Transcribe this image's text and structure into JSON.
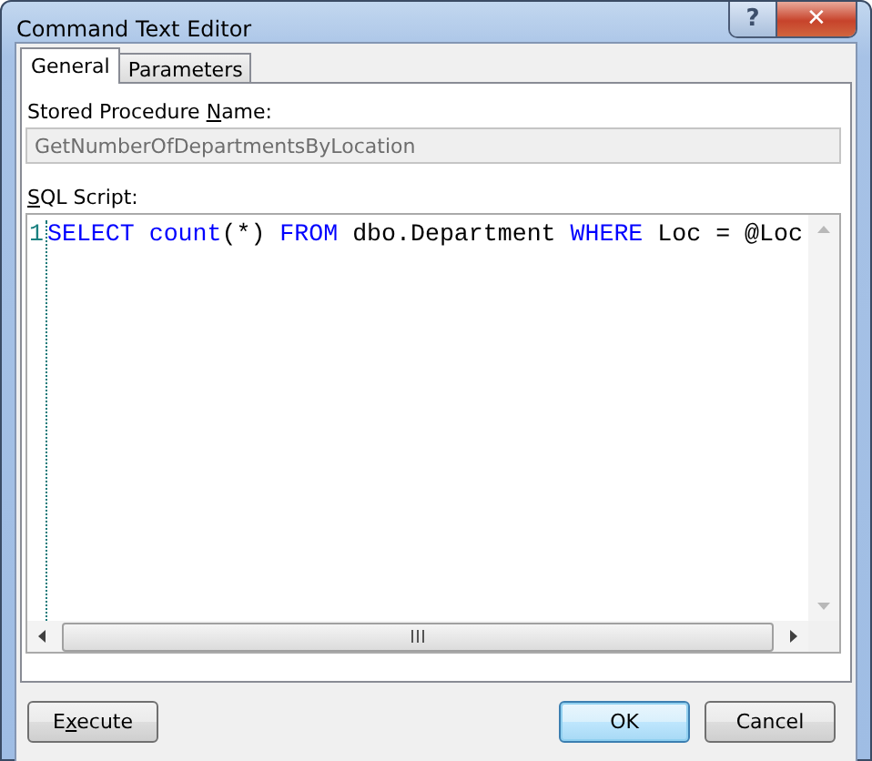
{
  "window": {
    "title": "Command Text Editor",
    "title_buttons": [
      {
        "kind": "help",
        "label": "?"
      },
      {
        "kind": "close",
        "label": "✕"
      }
    ]
  },
  "tabs": [
    {
      "label": "General",
      "selected": true
    },
    {
      "label": "Parameters",
      "selected": false
    }
  ],
  "stored_procedure": {
    "label": "Stored Procedure ",
    "access_key": "N",
    "label_rest": "ame:",
    "value": "GetNumberOfDepartmentsByLocation",
    "disabled": true
  },
  "sql_script": {
    "access_key": "S",
    "label_rest": "QL Script:",
    "lines": [
      {
        "number": "1",
        "tokens": [
          {
            "kind": "keyword",
            "text": "SELECT "
          },
          {
            "kind": "keyword",
            "text": "count"
          },
          {
            "kind": "plain",
            "text": "(*) "
          },
          {
            "kind": "keyword",
            "text": "FROM"
          },
          {
            "kind": "plain",
            "text": " dbo.Department "
          },
          {
            "kind": "keyword",
            "text": "WHERE"
          },
          {
            "kind": "plain",
            "text": " Loc = @Loc"
          }
        ]
      }
    ]
  },
  "buttons": [
    {
      "label": "E",
      "access_key": "x",
      "label_rest": "ecute",
      "default": false
    },
    {
      "label": "OK",
      "default": true
    },
    {
      "label": "Cancel",
      "default": false
    }
  ]
}
